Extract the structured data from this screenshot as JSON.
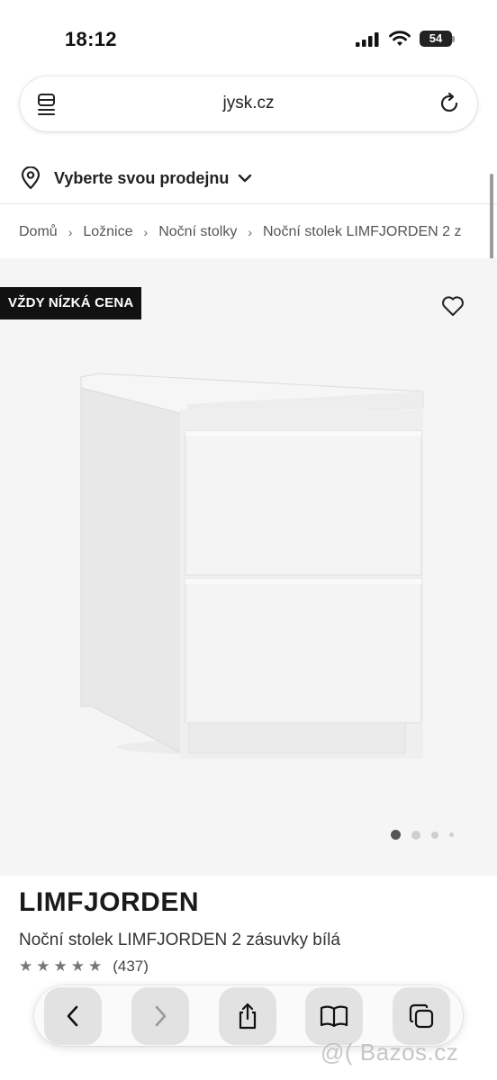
{
  "status_bar": {
    "time": "18:12",
    "battery": "54"
  },
  "browser": {
    "url": "jysk.cz"
  },
  "store_selector": {
    "label": "Vyberte svou prodejnu"
  },
  "breadcrumb": [
    "Domů",
    "Ložnice",
    "Noční stolky",
    "Noční stolek LIMFJORDEN 2 z"
  ],
  "product": {
    "badge": "VŽDY NÍZKÁ CENA",
    "brand": "LIMFJORDEN",
    "name": "Noční stolek LIMFJORDEN 2 zásuvky bílá",
    "rating_stars": "★★★★★",
    "rating_count": "(437)",
    "gallery_index": 1,
    "gallery_count": 4
  },
  "watermark": "@( Bazos.cz",
  "icons": {
    "status": [
      "signal-icon",
      "wifi-icon",
      "battery-icon"
    ],
    "url_bar": [
      "tab-menu-icon",
      "reload-icon"
    ],
    "store": [
      "location-pin-icon",
      "chevron-down-icon"
    ],
    "gallery": [
      "heart-icon"
    ],
    "toolbar": [
      "back-icon",
      "forward-icon",
      "share-icon",
      "bookmarks-icon",
      "tabs-icon"
    ]
  },
  "colors": {
    "badge_bg": "#111111",
    "gallery_bg": "#f5f5f5",
    "text": "#1f1f1f"
  }
}
